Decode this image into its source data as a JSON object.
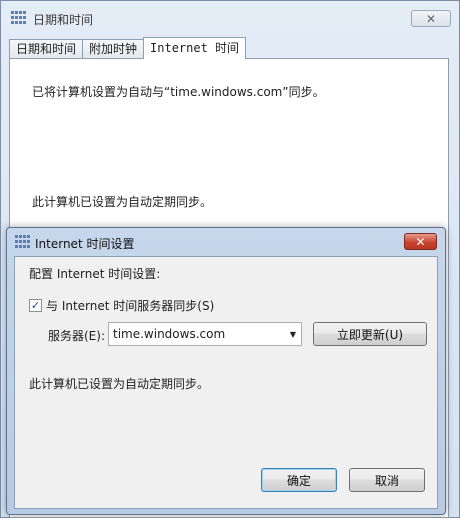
{
  "main_window": {
    "title": "日期和时间",
    "close_label": "✕",
    "tabs": [
      {
        "label": "日期和时间"
      },
      {
        "label": "附加时钟"
      },
      {
        "label": "Internet 时间"
      }
    ],
    "panel": {
      "line1": "已将计算机设置为自动与“time.windows.com”同步。",
      "line2": "此计算机已设置为自动定期同步。"
    }
  },
  "dialog": {
    "title": "Internet 时间设置",
    "close_label": "✕",
    "config_label": "配置 Internet 时间设置:",
    "sync_checkbox": {
      "checked": true,
      "mark": "✓",
      "label": "与 Internet 时间服务器同步(S)"
    },
    "server_label": "服务器(E):",
    "server_value": "time.windows.com",
    "dropdown_arrow": "▼",
    "update_button": "立即更新(U)",
    "status": "此计算机已设置为自动定期同步。",
    "ok_button": "确定",
    "cancel_button": "取消"
  },
  "icons": {
    "app": "calendar-clock-icon",
    "close": "close-icon"
  },
  "colors": {
    "close_red": "#c8442f",
    "titlebar_blue": "#c6d7ec"
  }
}
